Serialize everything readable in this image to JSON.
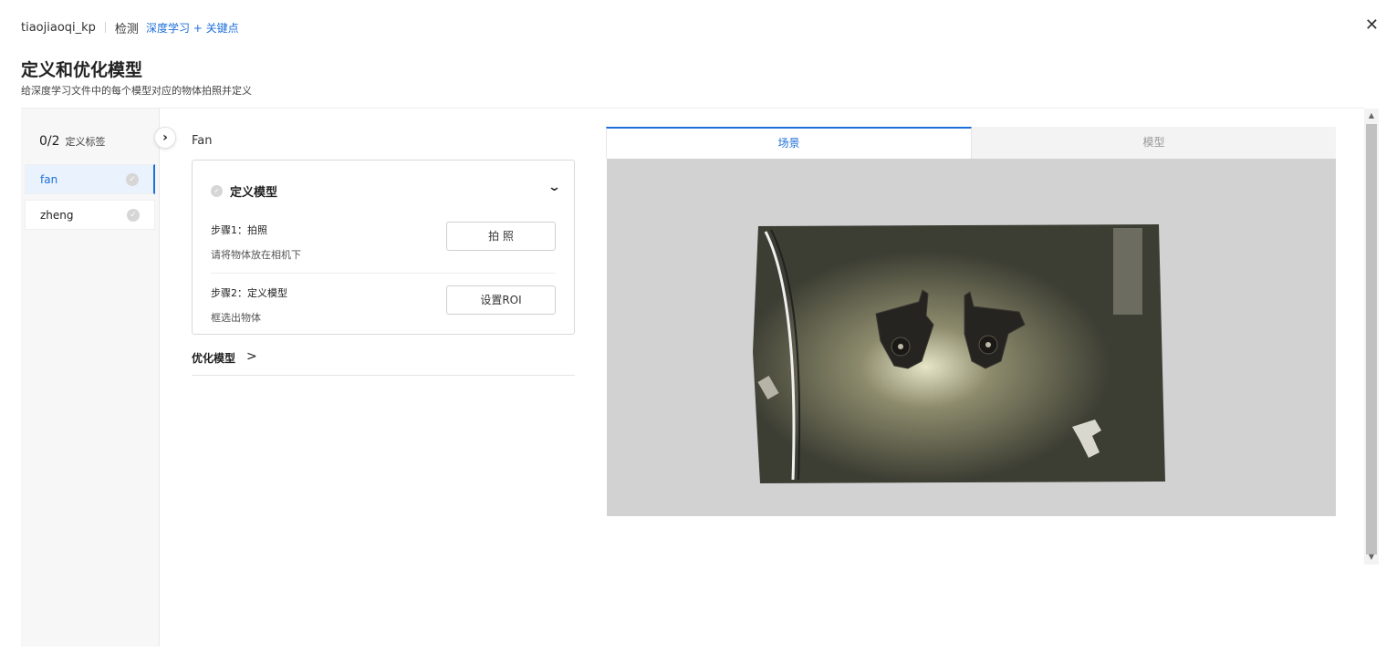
{
  "header": {
    "project": "tiaojiaoqi_kp",
    "kind": "检测",
    "method": "深度学习 + 关键点"
  },
  "page": {
    "title": "定义和优化模型",
    "subtitle": "给深度学习文件中的每个模型对应的物体拍照并定义"
  },
  "sidebar": {
    "count": "0/2",
    "label": "定义标签",
    "items": [
      {
        "label": "fan",
        "active": true
      },
      {
        "label": "zheng",
        "active": false
      }
    ]
  },
  "main": {
    "model_name": "Fan",
    "define_card": {
      "title": "定义模型",
      "step1_title": "步骤1：拍照",
      "step1_desc": "请将物体放在相机下",
      "step1_button": "拍 照",
      "step2_title": "步骤2：定义模型",
      "step2_desc": "框选出物体",
      "step2_button": "设置ROI"
    },
    "optimize_label": "优化模型"
  },
  "viewer": {
    "tabs": [
      {
        "label": "场景",
        "active": true
      },
      {
        "label": "模型",
        "active": false
      }
    ]
  },
  "colors": {
    "accent": "#1e6fd9",
    "viewer_background": "#d2d2d2",
    "sidebar_background": "#f7f7f7"
  },
  "icons": {
    "close": "close-icon",
    "expand": "chevron-right-icon",
    "collapse": "chevron-down-icon",
    "check": "check-circle-icon"
  }
}
